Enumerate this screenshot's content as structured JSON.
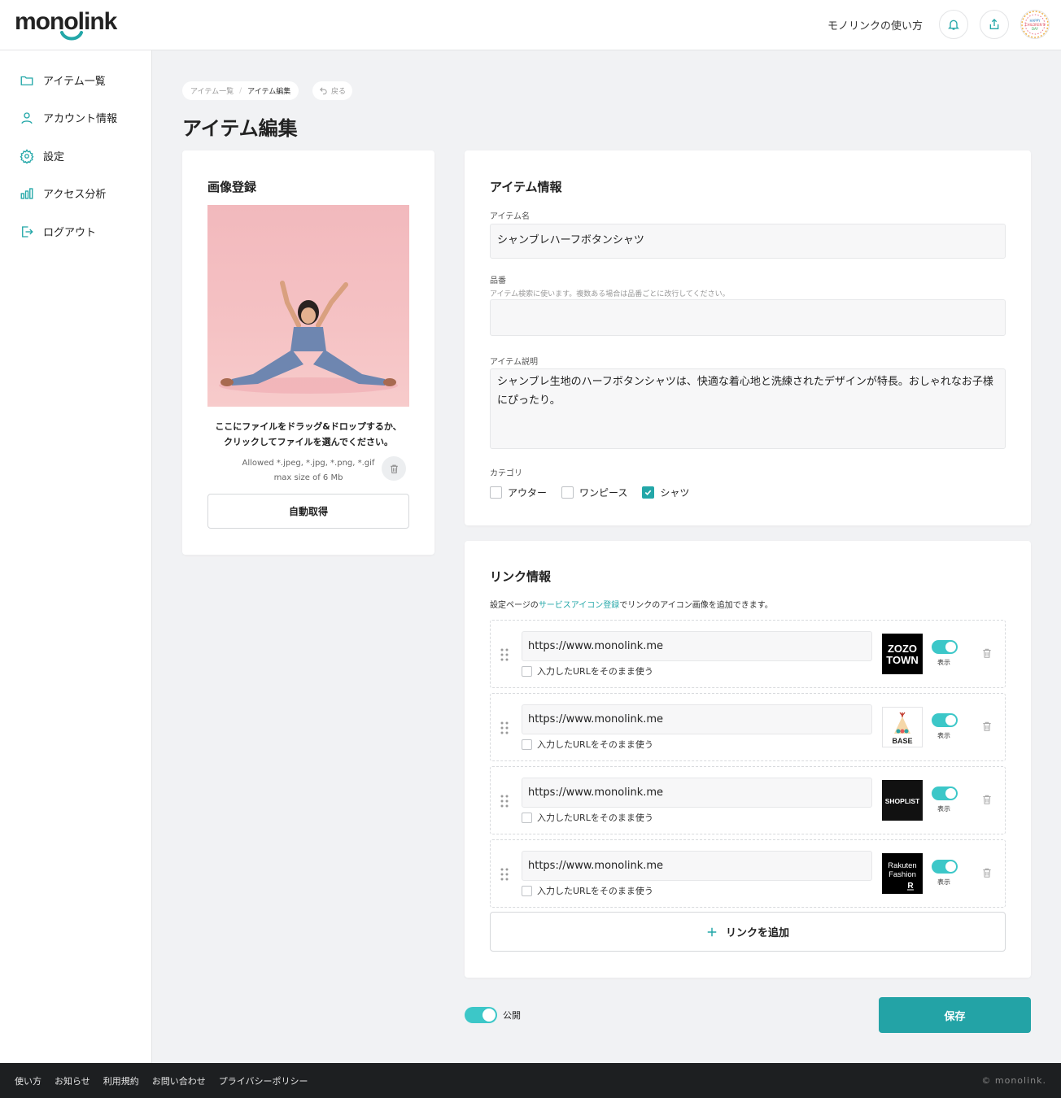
{
  "header": {
    "logo_text": "monolink",
    "howto_label": "モノリンクの使い方",
    "avatar_text": "HAPPY CHILDREN'S DAY"
  },
  "sidebar": {
    "items": [
      {
        "label": "アイテム一覧",
        "icon": "folder-icon"
      },
      {
        "label": "アカウント情報",
        "icon": "user-icon"
      },
      {
        "label": "設定",
        "icon": "gear-icon"
      },
      {
        "label": "アクセス分析",
        "icon": "bar-chart-icon"
      },
      {
        "label": "ログアウト",
        "icon": "logout-icon"
      }
    ]
  },
  "breadcrumb": {
    "items": [
      "アイテム一覧",
      "アイテム編集"
    ],
    "back_label": "戻る"
  },
  "page_title": "アイテム編集",
  "image_card": {
    "title": "画像登録",
    "drop_line1": "ここにファイルをドラッグ&ドロップするか、",
    "drop_line2": "クリックしてファイルを選んでください。",
    "allowed": "Allowed *.jpeg, *.jpg, *.png, *.gif",
    "max_size": "max size of 6 Mb",
    "auto_button": "自動取得"
  },
  "item_info": {
    "title": "アイテム情報",
    "name_label": "アイテム名",
    "name_value": "シャンブレハーフボタンシャツ",
    "number_label": "品番",
    "number_hint": "アイテム検索に使います。複数ある場合は品番ごとに改行してください。",
    "number_value": "",
    "desc_label": "アイテム説明",
    "desc_value": "シャンブレ生地のハーフボタンシャツは、快適な着心地と洗練されたデザインが特長。おしゃれなお子様にぴったり。",
    "category_label": "カテゴリ",
    "categories": [
      {
        "label": "アウター",
        "checked": false
      },
      {
        "label": "ワンピース",
        "checked": false
      },
      {
        "label": "シャツ",
        "checked": true
      }
    ]
  },
  "link_info": {
    "title": "リンク情報",
    "desc_before": "設定ページの",
    "desc_link": "サービスアイコン登録",
    "desc_after": "でリンクのアイコン画像を追加できます。",
    "use_as_is_label": "入力したURLをそのまま使う",
    "toggle_label": "表示",
    "links": [
      {
        "url": "https://www.monolink.me",
        "service": "ZOZO TOWN",
        "use_as_is": false,
        "visible": true
      },
      {
        "url": "https://www.monolink.me",
        "service": "BASE",
        "use_as_is": false,
        "visible": true
      },
      {
        "url": "https://www.monolink.me",
        "service": "SHOPLIST",
        "use_as_is": false,
        "visible": true
      },
      {
        "url": "https://www.monolink.me",
        "service": "Rakuten Fashion",
        "use_as_is": false,
        "visible": true
      }
    ],
    "add_button": "リンクを追加"
  },
  "publish_label": "公開",
  "publish_on": true,
  "save_button": "保存",
  "footer": {
    "links": [
      "使い方",
      "お知らせ",
      "利用規約",
      "お問い合わせ",
      "プライバシーポリシー"
    ],
    "copyright": "© monolink."
  },
  "colors": {
    "accent": "#23a7a8",
    "toggle": "#3cc7c8",
    "footer_bg": "#1d1f21"
  }
}
